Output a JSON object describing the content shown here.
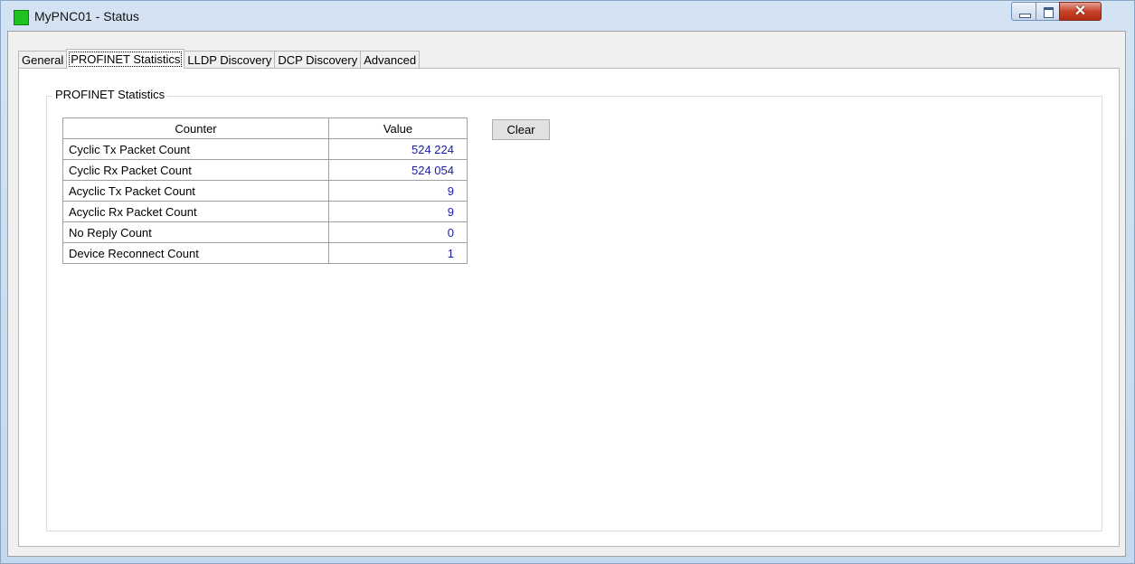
{
  "window": {
    "title": "MyPNC01 - Status",
    "icon": "green-status-square",
    "controls": {
      "minimize": "–",
      "maximize": "□",
      "close": "✕"
    }
  },
  "tabs": [
    {
      "label": "General",
      "active": false
    },
    {
      "label": "PROFINET Statistics",
      "active": true
    },
    {
      "label": "LLDP Discovery",
      "active": false
    },
    {
      "label": "DCP Discovery",
      "active": false
    },
    {
      "label": "Advanced",
      "active": false
    }
  ],
  "statistics": {
    "group_title": "PROFINET Statistics",
    "headers": {
      "counter": "Counter",
      "value": "Value"
    },
    "rows": [
      {
        "counter": "Cyclic Tx Packet Count",
        "value": "524 224"
      },
      {
        "counter": "Cyclic Rx Packet Count",
        "value": "524 054"
      },
      {
        "counter": "Acyclic Tx Packet Count",
        "value": "9"
      },
      {
        "counter": "Acyclic Rx Packet Count",
        "value": "9"
      },
      {
        "counter": "No Reply Count",
        "value": "0"
      },
      {
        "counter": "Device Reconnect Count",
        "value": "1"
      }
    ],
    "clear_label": "Clear"
  },
  "colors": {
    "value_text": "#1a1aa8",
    "status_icon": "#1fc21f",
    "close_button": "#c7432a"
  }
}
